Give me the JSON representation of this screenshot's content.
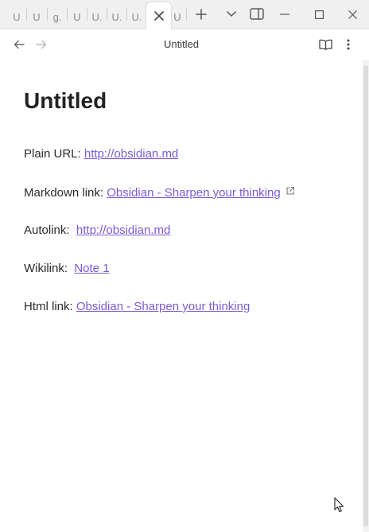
{
  "tabs": {
    "items": [
      "U",
      "U",
      "g.",
      "U",
      "U.",
      "U.",
      "U."
    ],
    "active_last": "U"
  },
  "nav": {
    "title": "Untitled"
  },
  "document": {
    "title": "Untitled",
    "lines": [
      {
        "label": "Plain URL:",
        "link": "http://obsidian.md"
      },
      {
        "label": "Markdown link:",
        "link": "Obsidian - Sharpen your thinking"
      },
      {
        "label": "Autolink:",
        "link": "http://obsidian.md"
      },
      {
        "label": "Wikilink:",
        "link": "Note 1"
      },
      {
        "label": "Html link:",
        "link": "Obsidian - Sharpen your thinking"
      }
    ]
  },
  "colors": {
    "link": "#7c5ad6",
    "tabbar_bg": "#f0f0f0"
  },
  "icons": [
    "close-tab-icon",
    "new-tab-icon",
    "chevron-down-icon",
    "sidebar-toggle-icon",
    "minimize-icon",
    "maximize-icon",
    "close-window-icon",
    "back-arrow-icon",
    "forward-arrow-icon",
    "reading-view-icon",
    "more-options-icon",
    "external-link-icon"
  ]
}
